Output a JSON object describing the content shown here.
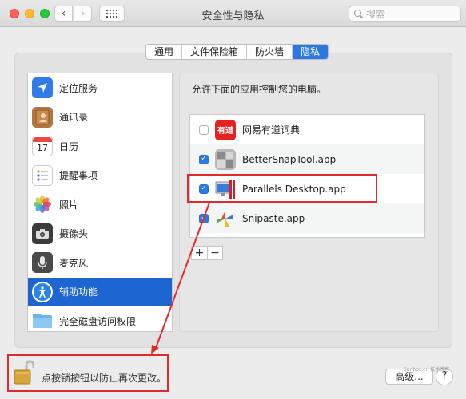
{
  "window": {
    "title": "安全性与隐私",
    "search_placeholder": "搜索"
  },
  "tabs": [
    {
      "label": "通用",
      "active": false
    },
    {
      "label": "文件保险箱",
      "active": false
    },
    {
      "label": "防火墙",
      "active": false
    },
    {
      "label": "隐私",
      "active": true
    }
  ],
  "sidebar": {
    "items": [
      {
        "label": "定位服务",
        "icon": "location-arrow-icon",
        "selected": false
      },
      {
        "label": "通讯录",
        "icon": "contacts-book-icon",
        "selected": false
      },
      {
        "label": "日历",
        "icon": "calendar-icon",
        "selected": false,
        "icon_text": "17"
      },
      {
        "label": "提醒事项",
        "icon": "reminders-list-icon",
        "selected": false
      },
      {
        "label": "照片",
        "icon": "photos-flower-icon",
        "selected": false
      },
      {
        "label": "摄像头",
        "icon": "camera-icon",
        "selected": false
      },
      {
        "label": "麦克风",
        "icon": "microphone-icon",
        "selected": false
      },
      {
        "label": "辅助功能",
        "icon": "accessibility-person-icon",
        "selected": true
      },
      {
        "label": "完全磁盘访问权限",
        "icon": "folder-icon",
        "selected": false
      }
    ]
  },
  "main": {
    "allow_label": "允许下面的应用控制您的电脑。",
    "apps": [
      {
        "name": "网易有道词典",
        "checked": false,
        "icon": "youdao-dict-icon",
        "icon_text": "有道"
      },
      {
        "name": "BetterSnapTool.app",
        "checked": true,
        "icon": "bettersnaptool-icon"
      },
      {
        "name": "Parallels Desktop.app",
        "checked": true,
        "icon": "parallels-desktop-icon"
      },
      {
        "name": "Snipaste.app",
        "checked": true,
        "icon": "snipaste-icon"
      }
    ],
    "add_label": "+",
    "remove_label": "−"
  },
  "footer": {
    "lock_text": "点按锁按钮以防止再次更改。",
    "advanced_label": "高级...",
    "help_label": "?",
    "watermark": "Sunbox.cn 技术博客"
  },
  "colors": {
    "accent": "#2a78e4",
    "selected_row": "#1d65d1",
    "annotation_red": "#e12b2b"
  }
}
